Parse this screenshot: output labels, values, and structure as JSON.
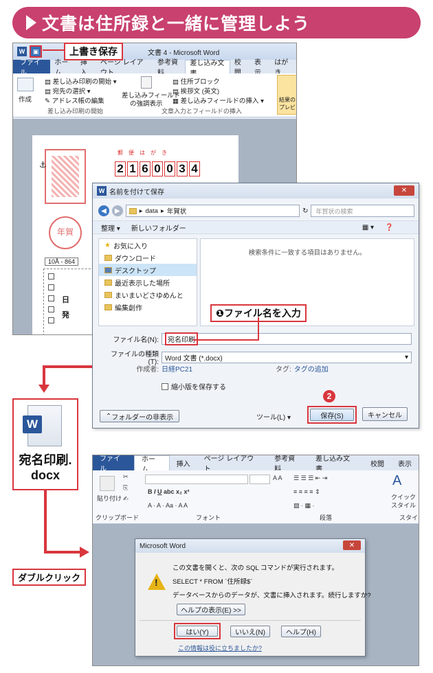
{
  "banner": {
    "title": "文書は住所録と一緒に管理しよう"
  },
  "callouts": {
    "overwrite_save": "上書き保存",
    "step1": "❶ファイル名を入力",
    "step2": "❷",
    "double_click": "ダブルクリック"
  },
  "word1": {
    "window_title": "文書 4 - Microsoft Word",
    "qat_w": "W",
    "tabs": [
      "ファイル",
      "ホーム",
      "挿入",
      "ページ レイアウト",
      "参考資料",
      "差し込み文書",
      "校閲",
      "表示",
      "はがき"
    ],
    "ribbon": {
      "create": "作成",
      "merge_start": "差し込み印刷の開始",
      "select_recipients": "宛先の選択",
      "edit_address_book": "アドレス帳の編集",
      "group_start": "差し込み印刷の開始",
      "highlight_fields_1": "差し込みフィールド",
      "highlight_fields_2": "の強調表示",
      "address_block": "住所ブロック",
      "greeting": "挨拶文 (英文)",
      "insert_merge_field": "差し込みフィールドの挿入",
      "group_fields": "文章入力とフィールドの挿入",
      "preview_1": "結果の",
      "preview_2": "プレビュー"
    },
    "postcard": {
      "zip_label": "郵便はがき",
      "zip_digits": [
        "2",
        "1",
        "6",
        "0",
        "0",
        "3",
        "4"
      ],
      "stamp_char": "年賀",
      "address_partial": "10Å - 864",
      "vertical_chars": [
        "日",
        "発"
      ]
    }
  },
  "save_dialog": {
    "title": "名前を付けて保存",
    "path": [
      "data",
      "年賀状"
    ],
    "search_placeholder": "年賀状の検索",
    "organize": "整理 ▾",
    "new_folder": "新しいフォルダー",
    "nav_items": [
      "お気に入り",
      "ダウンロード",
      "デスクトップ",
      "最近表示した場所",
      "まいまいどさゆめんと",
      "編集創作"
    ],
    "empty_message": "検索条件に一致する項目はありません。",
    "filename_label": "ファイル名(N):",
    "filename_value": "宛名印刷",
    "filetype_label": "ファイルの種類(T):",
    "filetype_value": "Word 文書 (*.docx)",
    "author_label": "作成者:",
    "author_value": "日経PC21",
    "tags_label": "タグ:",
    "tags_value": "タグの追加",
    "thumbnail": "縮小版を保存する",
    "hide_folders": "フォルダーの非表示",
    "tools": "ツール(L)",
    "save": "保存(S)",
    "cancel": "キャンセル"
  },
  "file_icon": {
    "name_line1": "宛名印刷.",
    "name_line2": "docx"
  },
  "word3": {
    "tabs": [
      "ファイル",
      "ホーム",
      "挿入",
      "ページ レイアウト",
      "参考資料",
      "差し込み文書",
      "校閲",
      "表示"
    ],
    "clipboard": "クリップボード",
    "paste": "貼り付け",
    "font_group": "フォント",
    "paragraph": "段落",
    "quick_style_1": "クイック",
    "quick_style_2": "スタイル",
    "style_group": "スタイ"
  },
  "message_box": {
    "title": "Microsoft Word",
    "line1": "この文書を開くと、次の SQL コマンドが実行されます。",
    "line2": "SELECT * FROM `住所録$`",
    "line3": "データベースからのデータが、文書に挿入されます。続行しますか?",
    "help": "ヘルプの表示(E) >>",
    "yes": "はい(Y)",
    "no": "いいえ(N)",
    "helpbtn": "ヘルプ(H)",
    "link": "この情報は役に立ちましたか?"
  },
  "colors": {
    "accent": "#c8416f",
    "callout_red": "#d9363e",
    "word_blue": "#2b579a"
  }
}
